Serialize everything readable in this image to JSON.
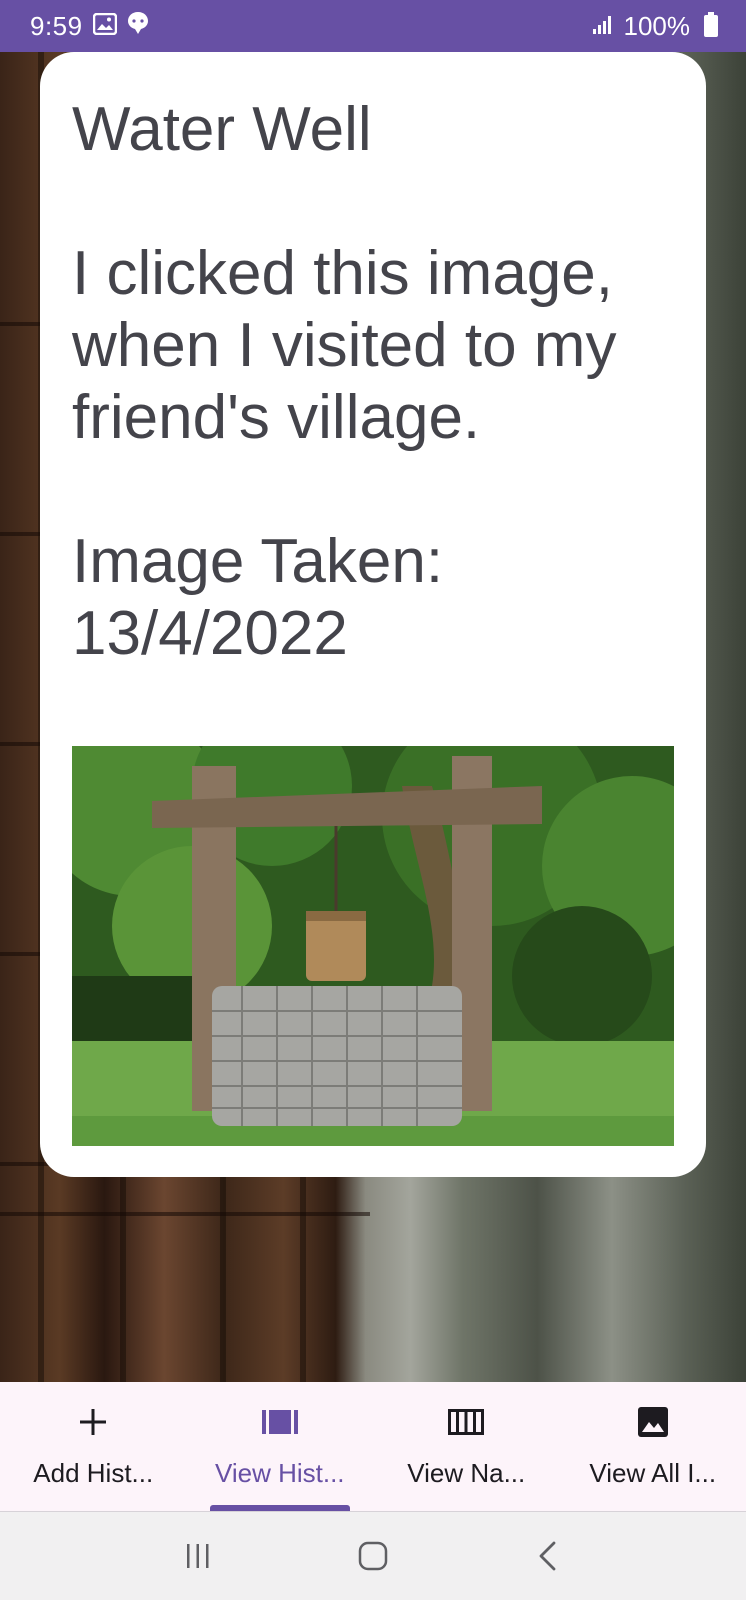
{
  "status_bar": {
    "time": "9:59",
    "battery": "100%",
    "icons": [
      "gallery-icon",
      "chat-bubble-icon",
      "signal-icon",
      "battery-icon"
    ]
  },
  "card": {
    "text": "Water Well\n\nI clicked this image, when I visited to my friend's village.\n\nImage Taken: 13/4/2022"
  },
  "bottom_nav": {
    "items": [
      {
        "label": "Add Hist...",
        "icon": "add-icon",
        "active": false
      },
      {
        "label": "View Hist...",
        "icon": "view-history-icon",
        "active": true
      },
      {
        "label": "View Na...",
        "icon": "view-column-icon",
        "active": false
      },
      {
        "label": "View All I...",
        "icon": "image-icon",
        "active": false
      }
    ]
  },
  "system_nav": {
    "buttons": [
      "recents-icon",
      "home-icon",
      "back-icon"
    ]
  },
  "colors": {
    "accent": "#6750a4",
    "card_text": "#44444b",
    "nav_background": "#fdf4fa"
  }
}
